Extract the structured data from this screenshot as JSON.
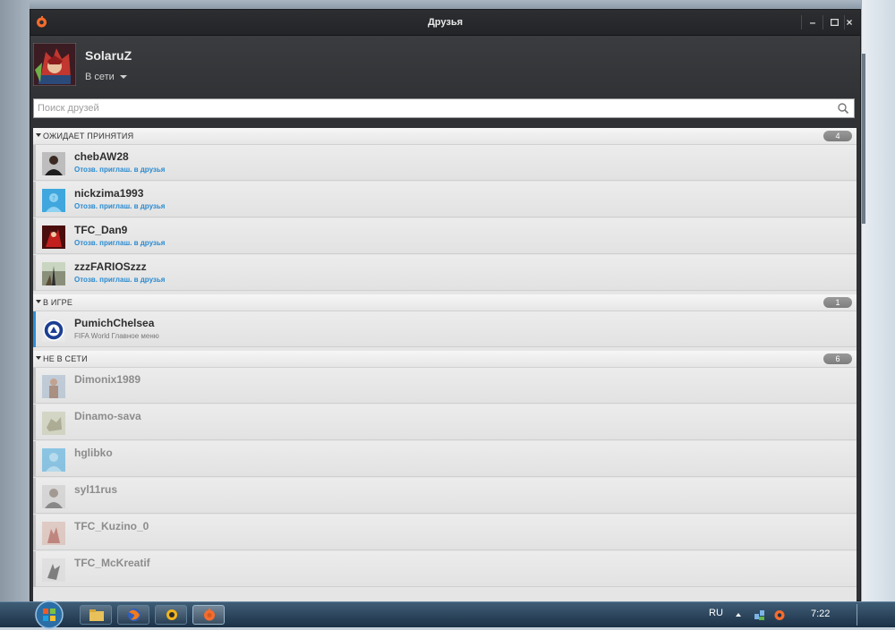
{
  "window": {
    "title": "Друзья"
  },
  "profile": {
    "username": "SolaruZ",
    "status": "В сети"
  },
  "search": {
    "placeholder": "Поиск друзей"
  },
  "groups": [
    {
      "label": "ОЖИДАЕТ ПРИНЯТИЯ",
      "count": "4",
      "friends": [
        {
          "name": "chebAW28",
          "sub": "Отозв. приглаш. в друзья"
        },
        {
          "name": "nickzima1993",
          "sub": "Отозв. приглаш. в друзья"
        },
        {
          "name": "TFC_Dan9",
          "sub": "Отозв. приглаш. в друзья"
        },
        {
          "name": "zzzFARIOSzzz",
          "sub": "Отозв. приглаш. в друзья"
        }
      ]
    },
    {
      "label": "В ИГРЕ",
      "count": "1",
      "friends": [
        {
          "name": "PumichChelsea",
          "sub": "FIFA World Главное меню"
        }
      ]
    },
    {
      "label": "НЕ В СЕТИ",
      "count": "6",
      "friends": [
        {
          "name": "Dimonix1989"
        },
        {
          "name": "Dinamo-sava"
        },
        {
          "name": "hglibko"
        },
        {
          "name": "syl11rus"
        },
        {
          "name": "TFC_Kuzino_0"
        },
        {
          "name": "TFC_McKreatif"
        }
      ]
    }
  ],
  "taskbar": {
    "language": "RU",
    "clock": "7:22"
  },
  "colors": {
    "accent": "#2d8fd8",
    "origin_orange": "#f56c2d",
    "window_bg": "#2f3134"
  }
}
